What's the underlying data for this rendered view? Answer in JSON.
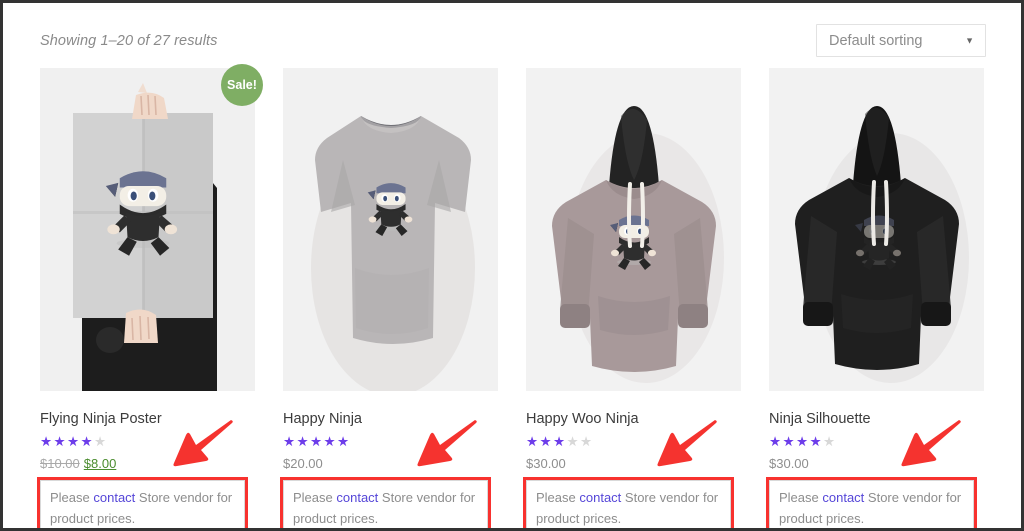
{
  "header": {
    "results_text": "Showing 1–20 of 27 results",
    "sorting": {
      "selected": "Default sorting",
      "caret_icon": "chevron-down-icon"
    }
  },
  "colors": {
    "sale_badge_bg": "#7fae64",
    "star_filled": "#6d3dea",
    "star_empty": "#d8d8d8",
    "sale_price": "#4a8c2e",
    "link": "#5546d8",
    "annotation_red": "#f8322f"
  },
  "notice": {
    "prefix": "Please ",
    "link": "contact",
    "suffix": " Store vendor for product prices."
  },
  "products": [
    {
      "title": "Flying Ninja Poster",
      "image_name": "flying-ninja-poster-image",
      "rating_filled": 4,
      "rating_total": 5,
      "on_sale": true,
      "sale_badge": "Sale!",
      "old_price": "$10.00",
      "price": "$8.00"
    },
    {
      "title": "Happy Ninja",
      "image_name": "happy-ninja-tshirt-image",
      "rating_filled": 5,
      "rating_total": 5,
      "on_sale": false,
      "sale_badge": "",
      "old_price": "",
      "price": "$20.00"
    },
    {
      "title": "Happy Woo Ninja",
      "image_name": "happy-woo-ninja-hoodie-image",
      "rating_filled": 3,
      "rating_total": 5,
      "on_sale": false,
      "sale_badge": "",
      "old_price": "",
      "price": "$30.00"
    },
    {
      "title": "Ninja Silhouette",
      "image_name": "ninja-silhouette-hoodie-image",
      "rating_filled": 4,
      "rating_total": 5,
      "on_sale": false,
      "sale_badge": "",
      "old_price": "",
      "price": "$30.00"
    }
  ]
}
